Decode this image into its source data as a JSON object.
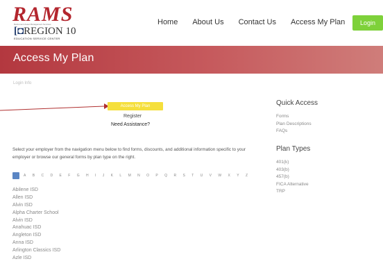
{
  "header": {
    "logo": {
      "brand": "RAMS",
      "tagline": "Retirement Asset Management Services",
      "region_mark": "[◘",
      "region": "REGION 10",
      "esc": "EDUCATION SERVICE CENTER"
    },
    "nav": [
      "Home",
      "About Us",
      "Contact Us",
      "Access My Plan"
    ],
    "login_label": "Login"
  },
  "banner": {
    "title": "Access My Plan"
  },
  "breadcrumb": "Login Info",
  "main": {
    "access_button": "Access My Plan",
    "register_link": "Register",
    "assistance_link": "Need Assistance?",
    "intro_text": "Select your employer from the navigation menu below to find forms, discounts, and additional information specific to your employer or browse our general forms by plan type on the right."
  },
  "alphabet": [
    "A",
    "B",
    "C",
    "D",
    "E",
    "F",
    "G",
    "H",
    "I",
    "J",
    "K",
    "L",
    "M",
    "N",
    "O",
    "P",
    "Q",
    "R",
    "S",
    "T",
    "U",
    "V",
    "W",
    "X",
    "Y",
    "Z"
  ],
  "districts": [
    "Abilene ISD",
    "Allen ISD",
    "Alvin ISD",
    "Alpha Charter School",
    "Alvin ISD",
    "Anahuac ISD",
    "Angleton ISD",
    "Anna ISD",
    "Arlington Classics ISD",
    "Azle ISD"
  ],
  "sidebar": {
    "quick_access": {
      "title": "Quick Access",
      "items": [
        "Forms",
        "Plan Descriptions",
        "FAQs"
      ]
    },
    "plan_types": {
      "title": "Plan Types",
      "items": [
        "401(k)",
        "403(b)",
        "457(b)",
        "FICA Alternative",
        "TRP"
      ]
    }
  },
  "colors": {
    "brand_red": "#b3262e",
    "banner": "#c0464b",
    "login_green": "#7ed13a",
    "access_yellow": "#f5df3c",
    "alpha_all_blue": "#5b86c4",
    "arrow_red": "#b03030"
  }
}
